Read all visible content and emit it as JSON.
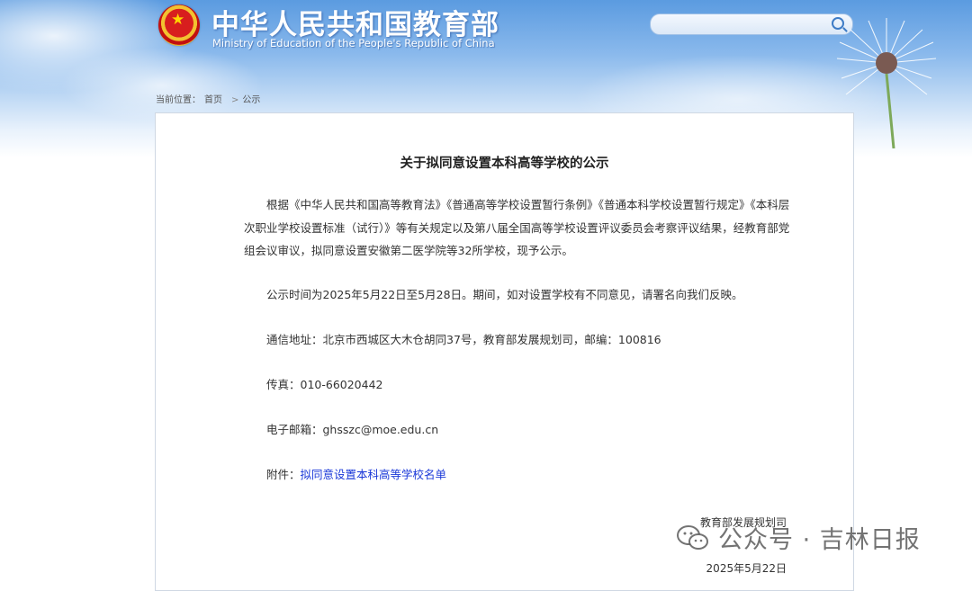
{
  "header": {
    "title": "中华人民共和国教育部",
    "subtitle": "Ministry of Education of the People's Republic of China",
    "search_placeholder": ""
  },
  "breadcrumb": {
    "label": "当前位置：",
    "items": [
      "首页",
      "公示"
    ],
    "separator": ">"
  },
  "article": {
    "title": "关于拟同意设置本科高等学校的公示",
    "paragraphs": [
      "根据《中华人民共和国高等教育法》《普通高等学校设置暂行条例》《普通本科学校设置暂行规定》《本科层次职业学校设置标准（试行）》等有关规定以及第八届全国高等学校设置评议委员会考察评议结果，经教育部党组会议审议，拟同意设置安徽第二医学院等32所学校，现予公示。",
      "公示时间为2025年5月22日至5月28日。期间，如对设置学校有不同意见，请署名向我们反映。",
      "通信地址：北京市西城区大木仓胡同37号，教育部发展规划司，邮编：100816",
      "传真：010-66020442",
      "电子邮箱：ghsszc@moe.edu.cn"
    ],
    "attachment_label": "附件：",
    "attachment_link": "拟同意设置本科高等学校名单",
    "signature": "教育部发展规划司",
    "date": "2025年5月22日"
  },
  "watermark": {
    "text": "公众号 · 吉林日报"
  },
  "colors": {
    "sky_top": "#5b9be0",
    "link": "#1a38d8",
    "text": "#333333"
  }
}
